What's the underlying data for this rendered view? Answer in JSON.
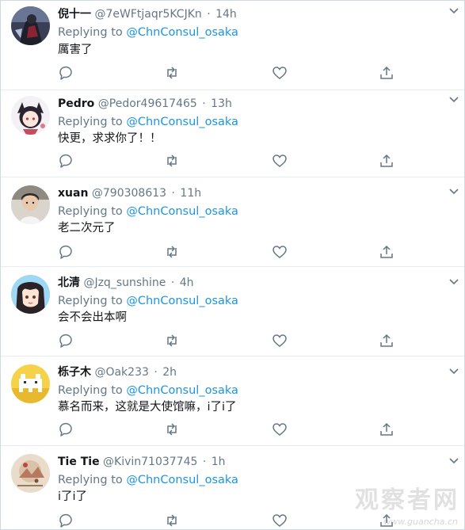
{
  "colors": {
    "name": "#14171a",
    "secondary": "#657786",
    "mention": "#1b95e0",
    "divider": "#e6ecf0"
  },
  "tweets": [
    {
      "name": "倪十一",
      "handle": "@7eWFtjaqr5KCJKn",
      "dot": "·",
      "time": "14h",
      "replying": "Replying to",
      "mention": "@ChnConsul_osaka",
      "text": "厲害了",
      "avatar": "dark-figure-avatar"
    },
    {
      "name": "Pedro",
      "handle": "@Pedor49617465",
      "dot": "·",
      "time": "13h",
      "replying": "Replying to",
      "mention": "@ChnConsul_osaka",
      "text": "快更，求求你了！！",
      "avatar": "chibi-girl-avatar"
    },
    {
      "name": "xuan",
      "handle": "@790308613",
      "dot": "·",
      "time": "11h",
      "replying": "Replying to",
      "mention": "@ChnConsul_osaka",
      "text": "老二次元了",
      "avatar": "photo-person-avatar"
    },
    {
      "name": "北清",
      "handle": "@Jzq_sunshine",
      "dot": "·",
      "time": "4h",
      "replying": "Replying to",
      "mention": "@ChnConsul_osaka",
      "text": "会不会出本啊",
      "avatar": "anime-girl-avatar"
    },
    {
      "name": "栎子木",
      "handle": "@Oak233",
      "dot": "·",
      "time": "2h",
      "replying": "Replying to",
      "mention": "@ChnConsul_osaka",
      "text": "慕名而来，这就是大使馆嘛，i了i了",
      "avatar": "pixel-creature-avatar"
    },
    {
      "name": "Tie Tie",
      "handle": "@Kivin71037745",
      "dot": "·",
      "time": "1h",
      "replying": "Replying to",
      "mention": "@ChnConsul_osaka",
      "text": "i了i了",
      "avatar": "illustration-avatar"
    }
  ],
  "actions": [
    "reply-icon",
    "retweet-icon",
    "like-icon",
    "share-icon"
  ],
  "watermark": {
    "text": "观察者网",
    "url": "www.guancha.cn"
  }
}
